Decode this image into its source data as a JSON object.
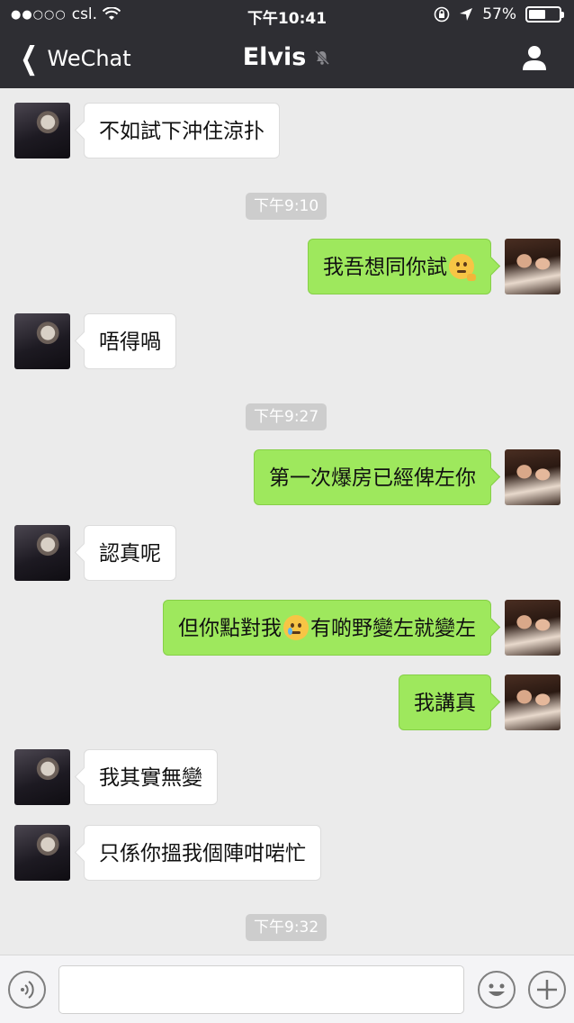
{
  "status_bar": {
    "carrier": "csl.",
    "signal_dots": "●●○○○",
    "time": "下午10:41",
    "battery": "57%",
    "battery_level": 0.57
  },
  "nav": {
    "back_label": "WeChat",
    "title": "Elvis"
  },
  "messages": [
    {
      "side": "in",
      "text": "不如試下沖住涼扑"
    },
    {
      "timestamp": "下午9:10"
    },
    {
      "side": "out",
      "text": "我吾想同你試",
      "emoji": "thinking-face"
    },
    {
      "side": "in",
      "text": "唔得喎"
    },
    {
      "timestamp": "下午9:27"
    },
    {
      "side": "out",
      "text": "第一次爆房已經俾左你"
    },
    {
      "side": "in",
      "text": "認真呢"
    },
    {
      "side": "out",
      "text_before": "但你點對我",
      "emoji": "crying-face",
      "text_after": "有啲野變左就變左"
    },
    {
      "side": "out",
      "text": "我講真"
    },
    {
      "side": "in",
      "text": "我其實無變"
    },
    {
      "side": "in",
      "text": "只係你搵我個陣咁啱忙"
    },
    {
      "timestamp": "下午9:32"
    }
  ],
  "input_bar": {
    "voice_icon": "voice-icon",
    "emoji_icon": "smiley-icon",
    "plus_icon": "plus-icon",
    "input_value": ""
  },
  "colors": {
    "nav_bg": "#2e2e33",
    "chat_bg": "#ebebeb",
    "bubble_out": "#9ee85d",
    "bubble_in": "#ffffff",
    "timestamp_bg": "#cdcdcd"
  }
}
